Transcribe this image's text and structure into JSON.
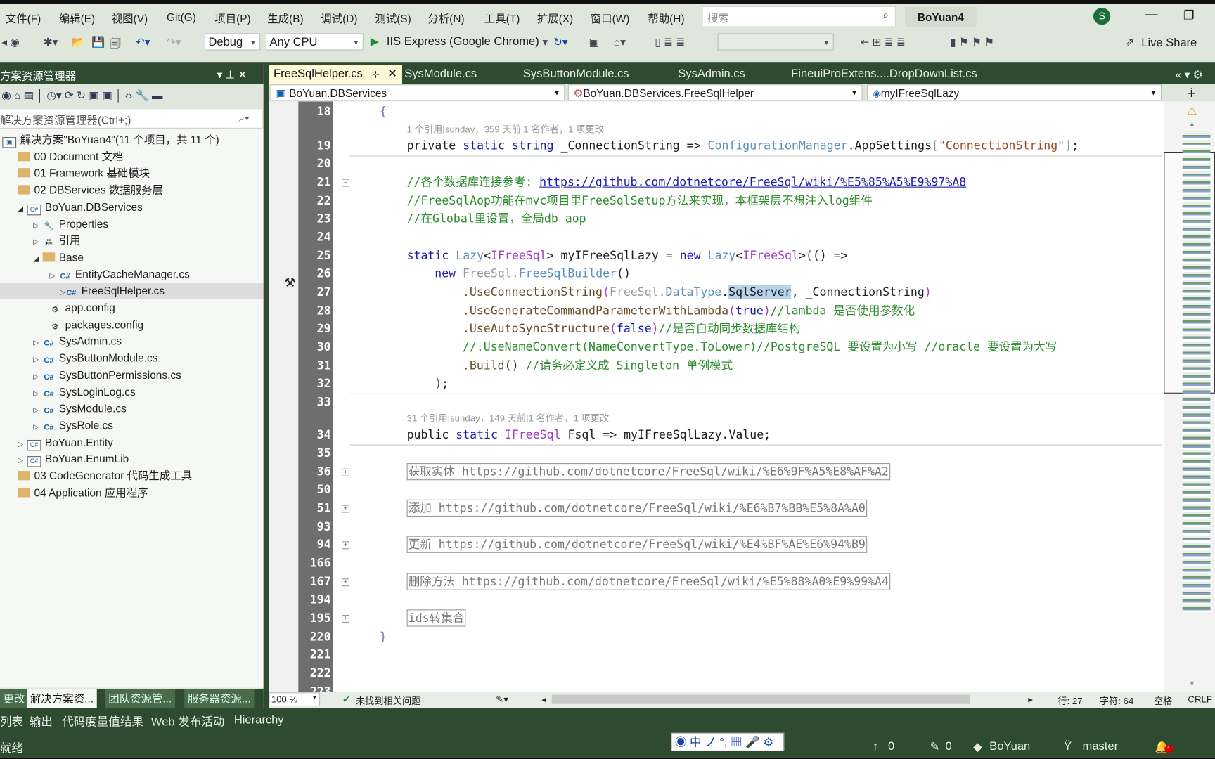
{
  "menu": [
    "文件(F)",
    "编辑(E)",
    "视图(V)",
    "Git(G)",
    "项目(P)",
    "生成(B)",
    "调试(D)",
    "测试(S)",
    "分析(N)",
    "工具(T)",
    "扩展(X)",
    "窗口(W)",
    "帮助(H)"
  ],
  "search_placeholder": "搜索",
  "title": "BoYuan4",
  "avatar": "S",
  "toolbar": {
    "config": "Debug",
    "platform": "Any CPU",
    "run": "IIS Express (Google Chrome)",
    "live_share": "Live Share"
  },
  "solution_explorer": {
    "title": "方案资源管理器",
    "search": "解决方案资源管理器(Ctrl+;)",
    "items": [
      {
        "label": "解决方案\"BoYuan4\"(11 个项目，共 11 个)",
        "level": 0,
        "icon": "solution"
      },
      {
        "label": "00 Document 文档",
        "level": 1,
        "icon": "folder"
      },
      {
        "label": "01 Framework 基础模块",
        "level": 1,
        "icon": "folder"
      },
      {
        "label": "02 DBServices 数据服务层",
        "level": 1,
        "icon": "folder"
      },
      {
        "label": "BoYuan.DBServices",
        "level": 2,
        "icon": "project",
        "tw": "◢"
      },
      {
        "label": "Properties",
        "level": 3,
        "icon": "wrench",
        "tw": "▷"
      },
      {
        "label": "引用",
        "level": 3,
        "icon": "refs",
        "tw": "▷"
      },
      {
        "label": "Base",
        "level": 3,
        "icon": "folder",
        "tw": "◢"
      },
      {
        "label": "EntityCacheManager.cs",
        "level": 4,
        "icon": "cs",
        "tw": "▷"
      },
      {
        "label": "FreeSqlHelper.cs",
        "level": 4,
        "icon": "cs",
        "tw": "▷",
        "selected": true
      },
      {
        "label": "app.config",
        "level": 3,
        "icon": "config"
      },
      {
        "label": "packages.config",
        "level": 3,
        "icon": "config"
      },
      {
        "label": "SysAdmin.cs",
        "level": 3,
        "icon": "cs",
        "tw": "▷"
      },
      {
        "label": "SysButtonModule.cs",
        "level": 3,
        "icon": "cs",
        "tw": "▷"
      },
      {
        "label": "SysButtonPermissions.cs",
        "level": 3,
        "icon": "cs",
        "tw": "▷"
      },
      {
        "label": "SysLoginLog.cs",
        "level": 3,
        "icon": "cs",
        "tw": "▷"
      },
      {
        "label": "SysModule.cs",
        "level": 3,
        "icon": "cs",
        "tw": "▷"
      },
      {
        "label": "SysRole.cs",
        "level": 3,
        "icon": "cs",
        "tw": "▷"
      },
      {
        "label": "BoYuan.Entity",
        "level": 2,
        "icon": "project",
        "tw": "▷"
      },
      {
        "label": "BoYuan.EnumLib",
        "level": 2,
        "icon": "project",
        "tw": "▷"
      },
      {
        "label": "03 CodeGenerator 代码生成工具",
        "level": 1,
        "icon": "folder"
      },
      {
        "label": "04 Application 应用程序",
        "level": 1,
        "icon": "folder"
      }
    ],
    "bottom_tabs": [
      "更改",
      "解决方案资...",
      "团队资源管...",
      "服务器资源..."
    ]
  },
  "doc_tabs": [
    "FreeSqlHelper.cs",
    "SysModule.cs",
    "SysButtonModule.cs",
    "SysAdmin.cs",
    "FineuiProExtens....DropDownList.cs"
  ],
  "nav": {
    "project": "BoYuan.DBServices",
    "class": "BoYuan.DBServices.FreeSqlHelper",
    "member": "myIFreeSqlLazy"
  },
  "codelens": [
    "1 个引用|sunday，359 天前|1 名作者，1 项更改",
    "31 个引用|sunday，149 天前|1 名作者，1 项更改"
  ],
  "line_numbers": [
    "18",
    "19",
    "20",
    "21",
    "22",
    "23",
    "24",
    "25",
    "26",
    "27",
    "28",
    "29",
    "30",
    "31",
    "32",
    "33",
    "34",
    "35",
    "36",
    "50",
    "51",
    "93",
    "94",
    "166",
    "167",
    "194",
    "195",
    "220",
    "221",
    "222",
    "223"
  ],
  "code": [
    {
      "ln": "18",
      "indent": 1,
      "tokens": [
        [
          "{",
          "p"
        ]
      ]
    },
    {
      "ln": "19",
      "indent": 2,
      "tokens": [
        [
          "private ",
          ""
        ],
        [
          "static string ",
          "k"
        ],
        [
          "_ConnectionString => ",
          ""
        ],
        [
          "ConfigurationManager",
          "t"
        ],
        [
          ".AppSettings",
          ""
        ],
        [
          "[",
          "g"
        ],
        [
          "\"ConnectionString\"",
          "s"
        ],
        [
          "]",
          "g"
        ],
        [
          ";",
          ""
        ]
      ]
    },
    {
      "ln": "21",
      "indent": 2,
      "tokens": [
        [
          "//各个数据库连接参考: ",
          "c"
        ],
        [
          "https://github.com/dotnetcore/FreeSql/wiki/%E5%85%A5%E9%97%A8",
          "u"
        ]
      ]
    },
    {
      "ln": "22",
      "indent": 2,
      "tokens": [
        [
          "//FreeSqlAop功能在mvc项目里FreeSqlSetup方法来实现，本框架层不想注入log组件",
          "c"
        ]
      ]
    },
    {
      "ln": "23",
      "indent": 2,
      "tokens": [
        [
          "//在Global里设置，全局db aop",
          "c"
        ]
      ]
    },
    {
      "ln": "25",
      "indent": 2,
      "tokens": [
        [
          "static ",
          "k"
        ],
        [
          "Lazy",
          "t"
        ],
        [
          "<",
          ""
        ],
        [
          "IFreeSql",
          "i"
        ],
        [
          "> myIFreeSqlLazy = ",
          ""
        ],
        [
          "new ",
          "k"
        ],
        [
          "Lazy",
          "t"
        ],
        [
          "<",
          ""
        ],
        [
          "IFreeSql",
          "i"
        ],
        [
          ">",
          ""
        ],
        [
          "(",
          "m"
        ],
        [
          "() =>",
          ""
        ]
      ]
    },
    {
      "ln": "26",
      "indent": 3,
      "tokens": [
        [
          "new ",
          "k"
        ],
        [
          "FreeSql.",
          "g"
        ],
        [
          "FreeSqlBuilder",
          "t"
        ],
        [
          "()",
          ""
        ]
      ]
    },
    {
      "ln": "27",
      "indent": 4,
      "tokens": [
        [
          ".UseConnectionString",
          "m"
        ],
        [
          "(",
          "i"
        ],
        [
          "FreeSql.",
          "g"
        ],
        [
          "DataType",
          "t"
        ],
        [
          ".",
          ""
        ],
        [
          "SqlServer",
          "hl"
        ],
        [
          ", _ConnectionString",
          ""
        ],
        [
          ")",
          "i"
        ]
      ]
    },
    {
      "ln": "28",
      "indent": 4,
      "tokens": [
        [
          ".UseGenerateCommandParameterWithLambda",
          "m"
        ],
        [
          "(",
          "i"
        ],
        [
          "true",
          "k"
        ],
        [
          ")",
          "i"
        ],
        [
          "//lambda 是否使用参数化",
          "c"
        ]
      ]
    },
    {
      "ln": "29",
      "indent": 4,
      "tokens": [
        [
          ".UseAutoSyncStructure",
          "m"
        ],
        [
          "(",
          "i"
        ],
        [
          "false",
          "k"
        ],
        [
          ")",
          "i"
        ],
        [
          "//是否自动同步数据库结构",
          "c"
        ]
      ]
    },
    {
      "ln": "30",
      "indent": 4,
      "tokens": [
        [
          "//.UseNameConvert(NameConvertType.ToLower)//PostgreSQL 要设置为小写 //oracle 要设置为大写",
          "c"
        ]
      ]
    },
    {
      "ln": "31",
      "indent": 4,
      "tokens": [
        [
          ".Build",
          "m"
        ],
        [
          "() ",
          ""
        ],
        [
          "//请务必定义成 Singleton 单例模式",
          "c"
        ]
      ]
    },
    {
      "ln": "32",
      "indent": 3,
      "tokens": [
        [
          ")",
          "m"
        ],
        [
          ";",
          ""
        ]
      ]
    },
    {
      "ln": "34",
      "indent": 2,
      "tokens": [
        [
          "public ",
          ""
        ],
        [
          "static ",
          "k"
        ],
        [
          "IFreeSql",
          "i"
        ],
        [
          " Fsql => myIFreeSqlLazy.Value;",
          ""
        ]
      ]
    },
    {
      "ln": "220",
      "indent": 1,
      "tokens": [
        [
          "}",
          "p"
        ]
      ]
    }
  ],
  "regions": [
    {
      "ln": "36",
      "text": "获取实体 https://github.com/dotnetcore/FreeSql/wiki/%E6%9F%A5%E8%AF%A2"
    },
    {
      "ln": "51",
      "text": "添加 https://github.com/dotnetcore/FreeSql/wiki/%E6%B7%BB%E5%8A%A0"
    },
    {
      "ln": "94",
      "text": "更新 https://github.com/dotnetcore/FreeSql/wiki/%E4%BF%AE%E6%94%B9"
    },
    {
      "ln": "167",
      "text": "删除方法 https://github.com/dotnetcore/FreeSql/wiki/%E5%88%A0%E9%99%A4"
    },
    {
      "ln": "195",
      "text": "ids转集合"
    }
  ],
  "editor_status": {
    "zoom": "100 %",
    "issues": "未找到相关问题",
    "line": "行: 27",
    "char": "字符: 64",
    "spaces": "空格",
    "eol": "CRLF"
  },
  "output_tabs": [
    "列表",
    "输出",
    "代码度量值结果",
    "Web 发布活动",
    "Hierarchy"
  ],
  "status": {
    "ready": "就绪",
    "up": "0",
    "pending": "0",
    "repo": "BoYuan",
    "branch": "master",
    "notifications": "1"
  },
  "ime": "中 ノ °, ▦ 🎤 ⚙",
  "colors": {
    "chrome": "#2e4a30",
    "menubar": "#dfe7dc",
    "gutter": "#6e6e6e",
    "selection": "#b8d3ec"
  }
}
